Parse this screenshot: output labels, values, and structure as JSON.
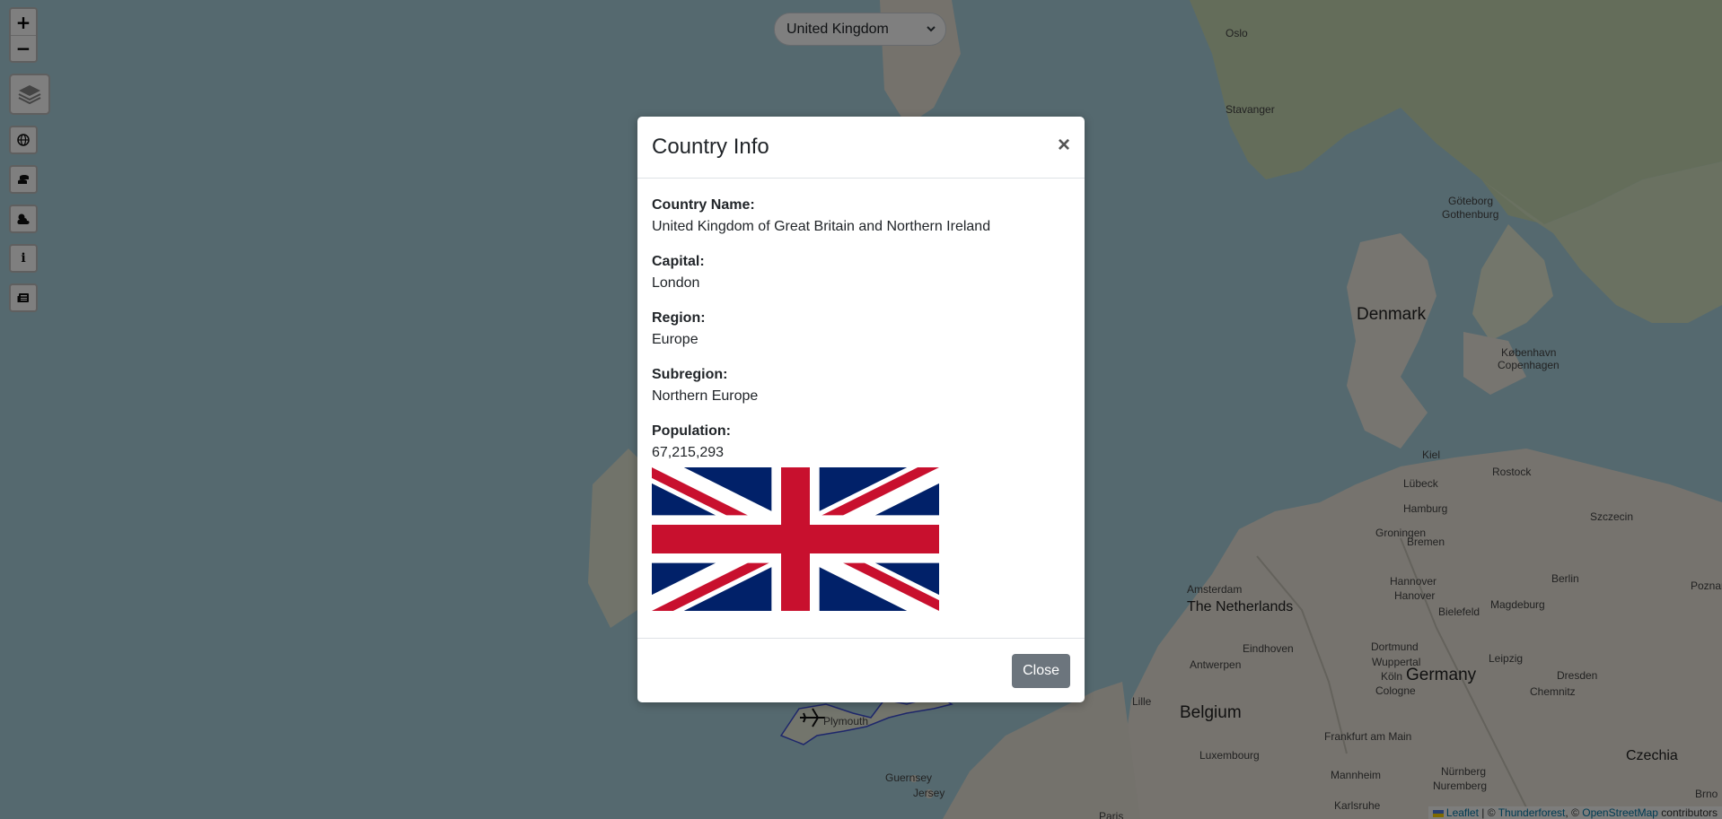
{
  "map": {
    "country_select": {
      "selected": "United Kingdom"
    },
    "controls": {
      "zoom_in": "+",
      "zoom_out": "−",
      "info_button": "i"
    },
    "places": [
      {
        "name": "Oslo",
        "size": "sm"
      },
      {
        "name": "Stavanger",
        "size": "sm"
      },
      {
        "name": "Göteborg",
        "size": "sm"
      },
      {
        "name": "Gothenburg",
        "size": "sm"
      },
      {
        "name": "Denmark",
        "size": "lg"
      },
      {
        "name": "København",
        "size": "sm"
      },
      {
        "name": "Copenhagen",
        "size": "sm"
      },
      {
        "name": "Kiel",
        "size": "sm"
      },
      {
        "name": "Rostock",
        "size": "sm"
      },
      {
        "name": "Lübeck",
        "size": "sm"
      },
      {
        "name": "Hamburg",
        "size": "sm"
      },
      {
        "name": "Szczecin",
        "size": "sm"
      },
      {
        "name": "Groningen",
        "size": "sm"
      },
      {
        "name": "Bremen",
        "size": "sm"
      },
      {
        "name": "Amsterdam",
        "size": "sm"
      },
      {
        "name": "The Netherlands",
        "size": "md"
      },
      {
        "name": "Hannover",
        "size": "sm"
      },
      {
        "name": "Hanover",
        "size": "sm"
      },
      {
        "name": "Berlin",
        "size": "sm"
      },
      {
        "name": "Bielefeld",
        "size": "sm"
      },
      {
        "name": "Magdeburg",
        "size": "sm"
      },
      {
        "name": "Poznań",
        "size": "sm"
      },
      {
        "name": "Eindhoven",
        "size": "sm"
      },
      {
        "name": "Dortmund",
        "size": "sm"
      },
      {
        "name": "Wuppertal",
        "size": "sm"
      },
      {
        "name": "Antwerpen",
        "size": "sm"
      },
      {
        "name": "Köln",
        "size": "sm"
      },
      {
        "name": "Cologne",
        "size": "sm"
      },
      {
        "name": "Leipzig",
        "size": "sm"
      },
      {
        "name": "Germany",
        "size": "lg"
      },
      {
        "name": "Dresden",
        "size": "sm"
      },
      {
        "name": "Chemnitz",
        "size": "sm"
      },
      {
        "name": "Lille",
        "size": "sm"
      },
      {
        "name": "Belgium",
        "size": "lg"
      },
      {
        "name": "Frankfurt am Main",
        "size": "sm"
      },
      {
        "name": "Luxembourg",
        "size": "sm"
      },
      {
        "name": "Czechia",
        "size": "md"
      },
      {
        "name": "Mannheim",
        "size": "sm"
      },
      {
        "name": "Nürnberg",
        "size": "sm"
      },
      {
        "name": "Nuremberg",
        "size": "sm"
      },
      {
        "name": "Karlsruhe",
        "size": "sm"
      },
      {
        "name": "Brno",
        "size": "sm"
      },
      {
        "name": "Guernsey",
        "size": "sm"
      },
      {
        "name": "Jersey",
        "size": "sm"
      },
      {
        "name": "Plymouth",
        "size": "sm"
      },
      {
        "name": "Paris",
        "size": "sm"
      }
    ],
    "attribution": {
      "leaflet": "Leaflet",
      "sep1": " | © ",
      "thunderforest": "Thunderforest",
      "sep2": ", © ",
      "osm": "OpenStreetMap",
      "tail": " contributors"
    },
    "colors": {
      "sea": "#aad3df",
      "land": "#f2efe9",
      "forest": "#c8dbb4"
    }
  },
  "modal": {
    "title": "Country Info",
    "close_glyph": "×",
    "fields": [
      {
        "label": "Country Name:",
        "value": "United Kingdom of Great Britain and Northern Ireland"
      },
      {
        "label": "Capital:",
        "value": "London"
      },
      {
        "label": "Region:",
        "value": "Europe"
      },
      {
        "label": "Subregion:",
        "value": "Northern Europe"
      },
      {
        "label": "Population:",
        "value": "67,215,293"
      }
    ],
    "flag_icon": "union-jack-flag",
    "footer_button": "Close",
    "colors": {
      "button": "#6c757d",
      "flag_blue": "#012169",
      "flag_red": "#C8102E"
    }
  }
}
